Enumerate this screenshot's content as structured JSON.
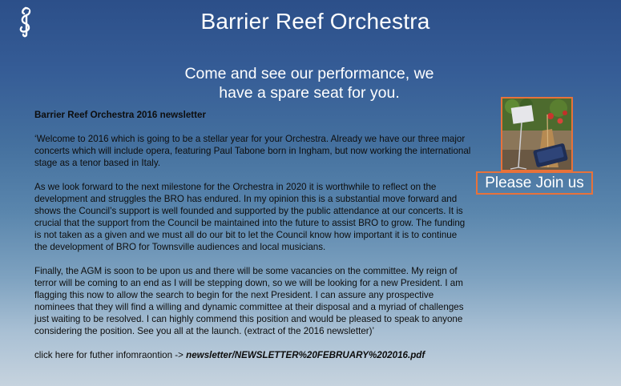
{
  "header": {
    "title": "Barrier Reef Orchestra",
    "tagline_line1": "Come and see our performance, we",
    "tagline_line2": "have a spare seat for you.",
    "logo_icon": "seahorse-treble-clef-icon"
  },
  "newsletter": {
    "heading": "Barrier Reef Orchestra 2016 newsletter",
    "paragraphs": [
      "‘Welcome to 2016 which is going to be a stellar year for your Orchestra. Already we have our three major concerts which will include opera, featuring Paul Tabone born in Ingham, but now working the international stage as a tenor based in Italy.",
      "As we look forward to the next milestone for the Orchestra in 2020 it is worthwhile to reflect on the development and struggles the BRO has endured. In my opinion this is a substantial move forward and shows the Council’s support is well founded and supported by the public attendance at our concerts.  It is crucial that the support from the Council be maintained into the future to assist BRO to grow.  The funding is not taken as a given and we must all do our bit to let the Council know how important it is to continue the development of BRO for Townsville audiences and local musicians.",
      "Finally, the AGM is soon to be upon us and there will be some vacancies on the committee.  My reign of terror will be coming to an end as I will be stepping down, so we will be looking for a new President.  I am flagging this now to allow the search to begin for the next President.  I can assure any prospective nominees that they will find a willing and dynamic committee at their disposal and a myriad of challenges just waiting to be resolved.  I can highly commend this position and would be pleased to speak to anyone considering the position.  See you all at the launch. (extract of the 2016 newsletter)’"
    ],
    "link_prefix": "click here for futher infomraontion -> ",
    "link_text": "newsletter/NEWSLETTER%20FEBRUARY%202016.pdf"
  },
  "sidebar": {
    "photo_icon": "orchestra-instruments-photo",
    "join_label": "Please Join us"
  },
  "colors": {
    "accent_border": "#e8723a",
    "sky_top": "#2c4f89",
    "sky_bottom": "#c6d3de",
    "heading_text": "#ffffff"
  }
}
